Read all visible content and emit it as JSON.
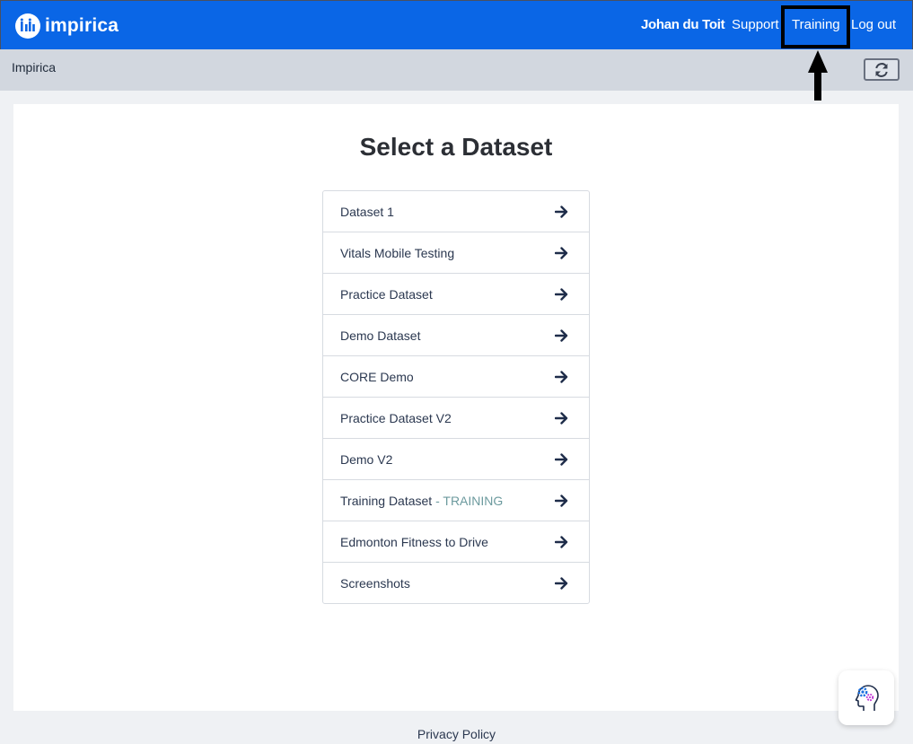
{
  "navbar": {
    "brand": "impirica",
    "user_name": "Johan du Toit",
    "support_label": "Support",
    "training_label": "Training",
    "logout_label": "Log out",
    "brand_color": "#0a66e6"
  },
  "subheader": {
    "title": "Impirica",
    "refresh_icon": "refresh-icon"
  },
  "main": {
    "title": "Select a Dataset",
    "datasets": [
      {
        "label": "Dataset 1",
        "tag": ""
      },
      {
        "label": "Vitals Mobile Testing",
        "tag": ""
      },
      {
        "label": "Practice Dataset",
        "tag": ""
      },
      {
        "label": "Demo Dataset",
        "tag": ""
      },
      {
        "label": "CORE Demo",
        "tag": ""
      },
      {
        "label": "Practice Dataset V2",
        "tag": ""
      },
      {
        "label": "Demo V2",
        "tag": ""
      },
      {
        "label": "Training Dataset",
        "tag": " - TRAINING"
      },
      {
        "label": "Edmonton Fitness to Drive",
        "tag": ""
      },
      {
        "label": "Screenshots",
        "tag": ""
      }
    ]
  },
  "footer": {
    "privacy_label": "Privacy Policy"
  },
  "help": {
    "icon": "help-assistant-icon"
  }
}
